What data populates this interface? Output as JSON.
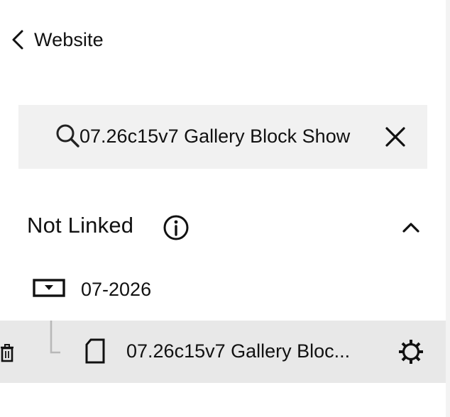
{
  "nav": {
    "back_label": "Website",
    "back_icon": "chevron-left-icon"
  },
  "search": {
    "value": "07.26c15v7 Gallery Block Show",
    "icon": "search-icon",
    "clear_icon": "close-icon"
  },
  "section": {
    "title": "Not Linked",
    "info_icon": "info-icon",
    "collapse_icon": "chevron-up-icon",
    "expanded": true
  },
  "folder": {
    "label": "07-2026",
    "icon": "folder-icon"
  },
  "page_item": {
    "label": "07.26c15v7 Gallery Bloc...",
    "icon": "page-icon",
    "delete_icon": "trash-icon",
    "settings_icon": "gear-icon"
  },
  "colors": {
    "search_bg": "#f1f1f1",
    "selected_row_bg": "#e8e8e8",
    "text": "#111111",
    "tree_line": "#b8b8b8"
  }
}
